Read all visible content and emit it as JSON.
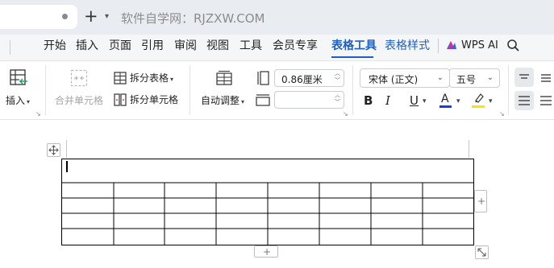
{
  "titlebar": {
    "new_tab_icon": "plus-icon",
    "new_tab_menu_icon": "chevron-down-icon",
    "watermark": "软件自学网：RJZXW.COM"
  },
  "menu": {
    "items": [
      "开始",
      "插入",
      "页面",
      "引用",
      "审阅",
      "视图",
      "工具",
      "会员专享",
      "表格工具",
      "表格样式"
    ],
    "active": "表格工具",
    "ai_label": "WPS AI",
    "ai_accent": "#3d5afe",
    "search_icon": "search-icon",
    "accent": "#1f5fbf"
  },
  "ribbon": {
    "insert": {
      "label": "插入"
    },
    "merge": {
      "label": "合并单元格"
    },
    "split_table": {
      "label": "拆分表格"
    },
    "split_cell": {
      "label": "拆分单元格"
    },
    "autofit": {
      "label": "自动调整"
    },
    "row_height": {
      "value": "0.86厘米"
    },
    "col_width": {
      "value": ""
    },
    "font": {
      "name": "宋体 (正文)",
      "size": "五号"
    },
    "format": {
      "bold": "B",
      "italic": "I",
      "underline": "U",
      "font_color": "A",
      "font_color_hex": "#1a3fd6",
      "highlight_hex": "#f2e800"
    }
  },
  "document": {
    "table": {
      "rows": 5,
      "cols": 8,
      "merged_first_row": true
    }
  }
}
